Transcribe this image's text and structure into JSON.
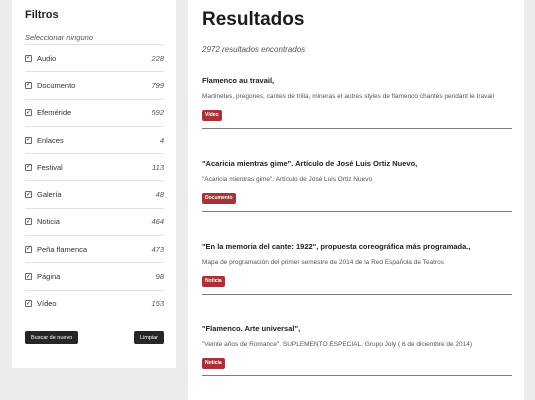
{
  "sidebar": {
    "title": "Filtros",
    "select_none": "Seleccionar ninguno",
    "check_glyph": "✓",
    "filters": [
      {
        "label": "Audio",
        "count": "228"
      },
      {
        "label": "Documento",
        "count": "799"
      },
      {
        "label": "Efeméride",
        "count": "592"
      },
      {
        "label": "Enlaces",
        "count": "4"
      },
      {
        "label": "Festival",
        "count": "113"
      },
      {
        "label": "Galería",
        "count": "48"
      },
      {
        "label": "Noticia",
        "count": "464"
      },
      {
        "label": "Peña flamenca",
        "count": "473"
      },
      {
        "label": "Página",
        "count": "98"
      },
      {
        "label": "Vídeo",
        "count": "153"
      }
    ],
    "search_again_label": "Buscar de nuevo",
    "clear_label": "Limpiar"
  },
  "main": {
    "title": "Resultados",
    "count_text": "2972 resultados encontrados",
    "results": [
      {
        "title": "Flamenco au travail,",
        "snippet": "Martinetes, pregones, cantes de trilla, mineras et autres styles de flamenco chantés pendant le travail",
        "tag": "Vídeo"
      },
      {
        "title": "\"Acaricia mientras gime\". Artículo de José Luis Ortiz Nuevo,",
        "snippet": "\"Acaricia mientras gime\". Artículo de José Luis Ortiz Nuevo",
        "tag": "Documento"
      },
      {
        "title": "\"En la memoria del cante: 1922\", propuesta coreográfica más programada.,",
        "snippet": "Mapa de programación del primer semestre de 2014 de la Red Española de Teatros",
        "tag": "Noticia"
      },
      {
        "title": "\"Flamenco. Arte universal\",",
        "snippet": "\"Veinte años de Romance\".  SUPLEMENTO ESPECIAL.  Grupo Joly ( 6 de diciembre de 2014)",
        "tag": "Noticia"
      }
    ]
  },
  "colors": {
    "page_bg": "#ececec",
    "panel_bg": "#ffffff",
    "tag_bg": "#a9323a",
    "button_bg": "#262626"
  }
}
